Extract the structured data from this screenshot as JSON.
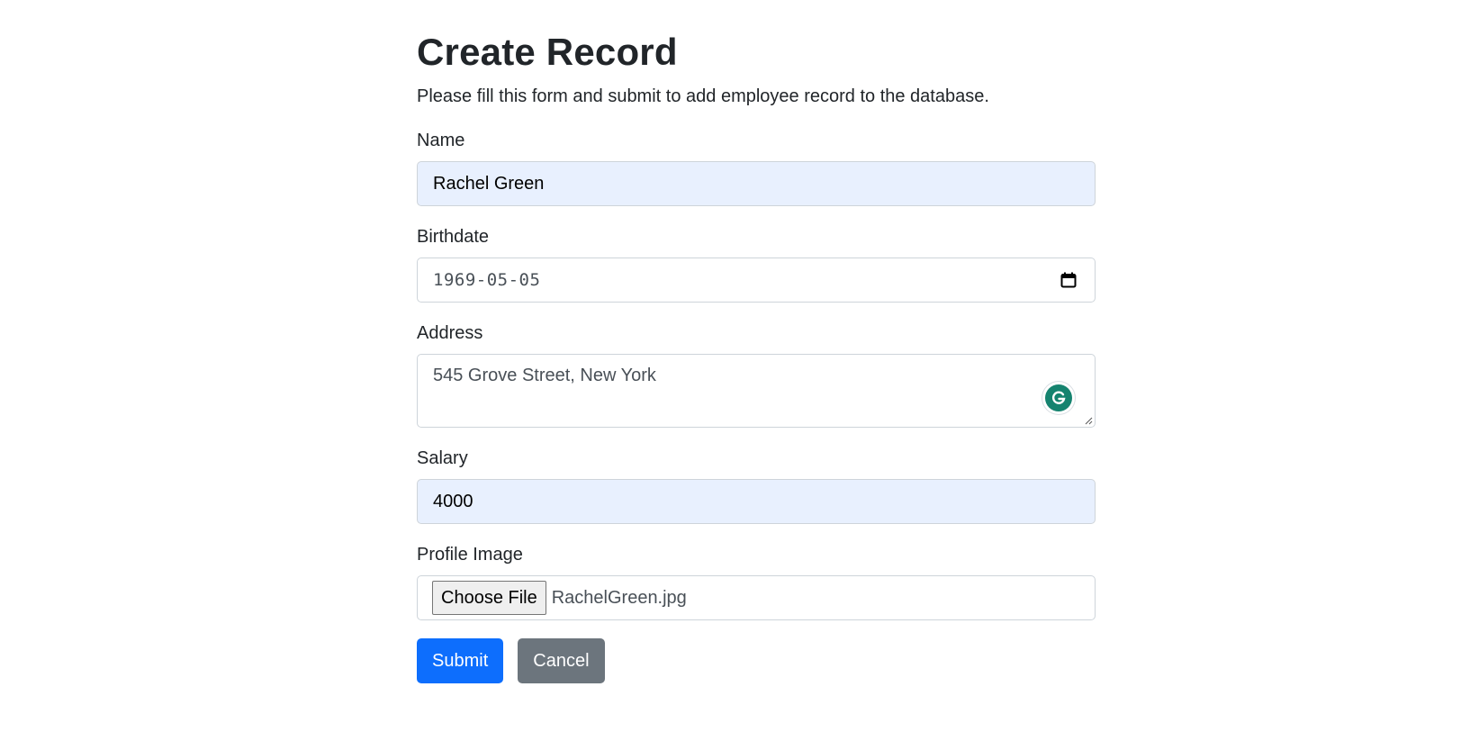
{
  "page": {
    "title": "Create Record",
    "subtitle": "Please fill this form and submit to add employee record to the database."
  },
  "form": {
    "name": {
      "label": "Name",
      "value": "Rachel Green"
    },
    "birthdate": {
      "label": "Birthdate",
      "value": "1969-05-05",
      "icon": "calendar-icon"
    },
    "address": {
      "label": "Address",
      "value": "545 Grove Street, New York",
      "icon": "grammarly-icon"
    },
    "salary": {
      "label": "Salary",
      "value": "4000"
    },
    "profile_image": {
      "label": "Profile Image",
      "button_label": "Choose File",
      "file_name": "RachelGreen.jpg"
    }
  },
  "actions": {
    "submit_label": "Submit",
    "cancel_label": "Cancel"
  },
  "colors": {
    "primary": "#0d6efd",
    "secondary": "#6c757d",
    "autofill": "#e8f0fe",
    "grammarly": "#15836f"
  }
}
